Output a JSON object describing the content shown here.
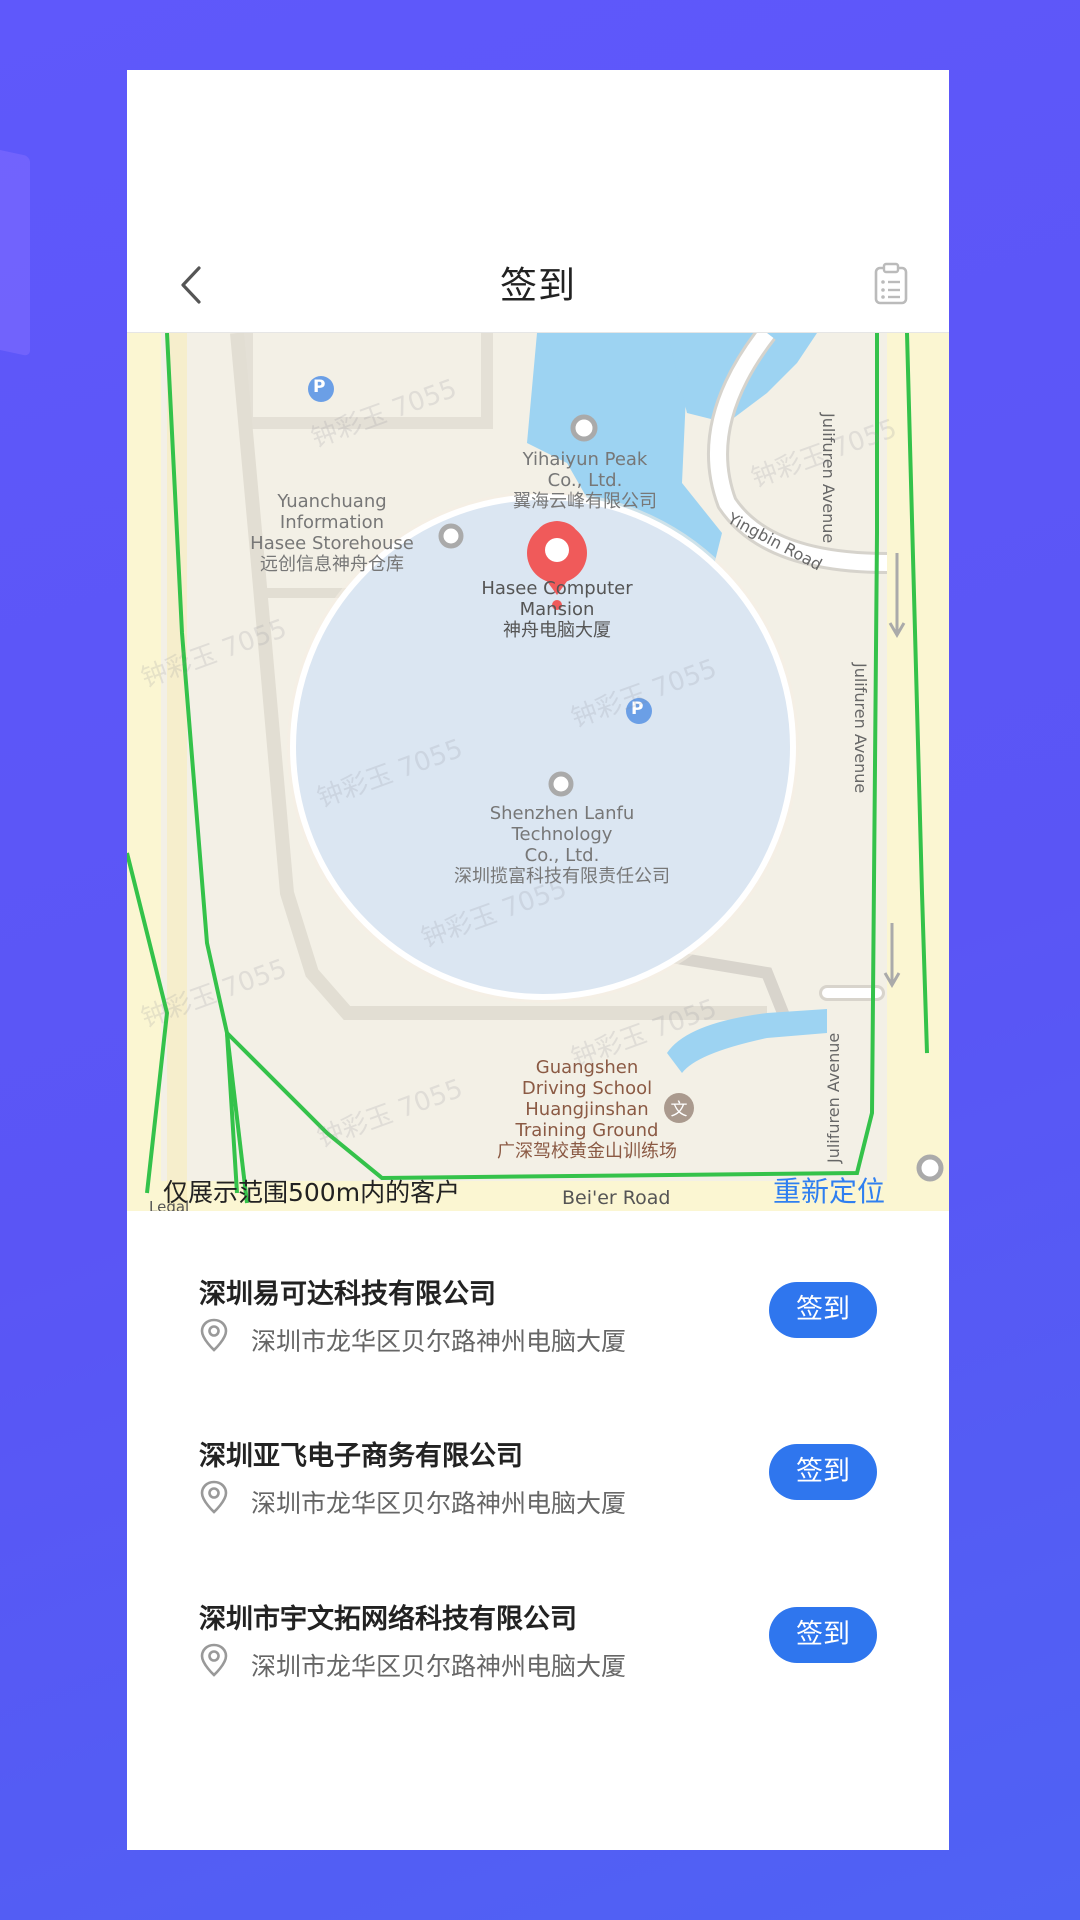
{
  "header": {
    "title": "签到"
  },
  "map": {
    "labels": {
      "poi_yihaiyun_en_1": "Yihaiyun Peak",
      "poi_yihaiyun_en_2": "Co., Ltd.",
      "poi_yihaiyun_zh": "翼海云峰有限公司",
      "poi_yuanchuang_en_1": "Yuanchuang",
      "poi_yuanchuang_en_2": "Information",
      "poi_yuanchuang_en_3": "Hasee Storehouse",
      "poi_yuanchuang_zh": "远创信息神舟仓库",
      "poi_hasee_en_1": "Hasee Computer",
      "poi_hasee_en_2": "Mansion",
      "poi_hasee_zh": "神舟电脑大厦",
      "poi_lanfu_en_1": "Shenzhen Lanfu",
      "poi_lanfu_en_2": "Technology",
      "poi_lanfu_en_3": "Co., Ltd.",
      "poi_lanfu_zh": "深圳揽富科技有限责任公司",
      "poi_driving_en_1": "Guangshen",
      "poi_driving_en_2": "Driving School",
      "poi_driving_en_3": "Huangjinshan",
      "poi_driving_en_4": "Training Ground",
      "poi_driving_zh": "广深驾校黄金山训练场",
      "road_yingbin": "Yingbin Road",
      "road_julifuren_1": "Julifuren Avenue",
      "road_julifuren_2": "Julifuren Avenue",
      "road_julifuren_3": "Julifuren Avenue",
      "road_beier": "Bei'er Road",
      "legal": "Legal",
      "parking": "P"
    },
    "watermark": "钟彩玉 7055"
  },
  "nearby": {
    "range_text": "仅展示范围500m内的客户",
    "relocate_label": "重新定位",
    "items": [
      {
        "name": "深圳易可达科技有限公司",
        "address": "深圳市龙华区贝尔路神州电脑大厦",
        "button": "签到"
      },
      {
        "name": "深圳亚飞电子商务有限公司",
        "address": "深圳市龙华区贝尔路神州电脑大厦",
        "button": "签到"
      },
      {
        "name": "深圳市宇文拓网络科技有限公司",
        "address": "深圳市龙华区贝尔路神州电脑大厦",
        "button": "签到"
      }
    ]
  },
  "colors": {
    "accent": "#2f76ee",
    "link": "#2f7ff0",
    "background": "#5f58fb",
    "pin": "#f05a5a",
    "boundary": "#34c24a"
  },
  "icons": {
    "back": "chevron-left-icon",
    "clipboard": "clipboard-icon",
    "location": "map-pin-icon"
  }
}
